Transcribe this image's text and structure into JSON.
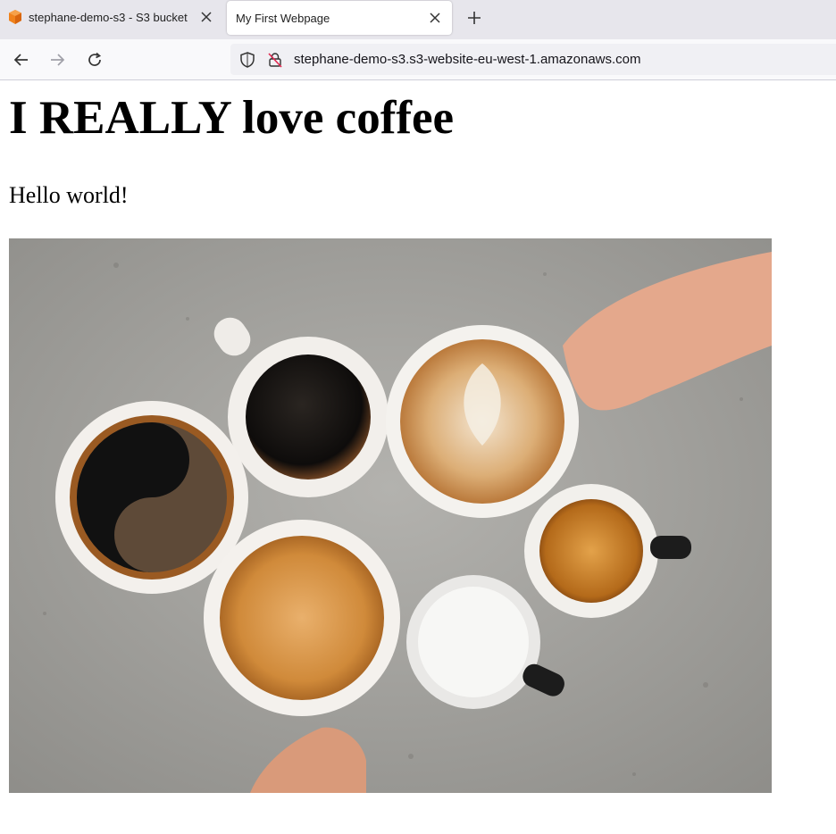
{
  "browser": {
    "tabs": [
      {
        "title": "stephane-demo-s3 - S3 bucket",
        "favicon": "aws-s3-bucket-icon",
        "active": false
      },
      {
        "title": "My First Webpage",
        "active": true
      }
    ],
    "address": "stephane-demo-s3.s3-website-eu-west-1.amazonaws.com",
    "icons": [
      "back-arrow-icon",
      "forward-arrow-icon",
      "reload-icon",
      "shield-icon",
      "insecure-lock-icon",
      "close-icon",
      "plus-icon"
    ]
  },
  "page": {
    "heading": "I REALLY love coffee",
    "text": "Hello world!",
    "image": {
      "subject": "coffee-cups-photo",
      "background": "#9d9c98"
    }
  }
}
